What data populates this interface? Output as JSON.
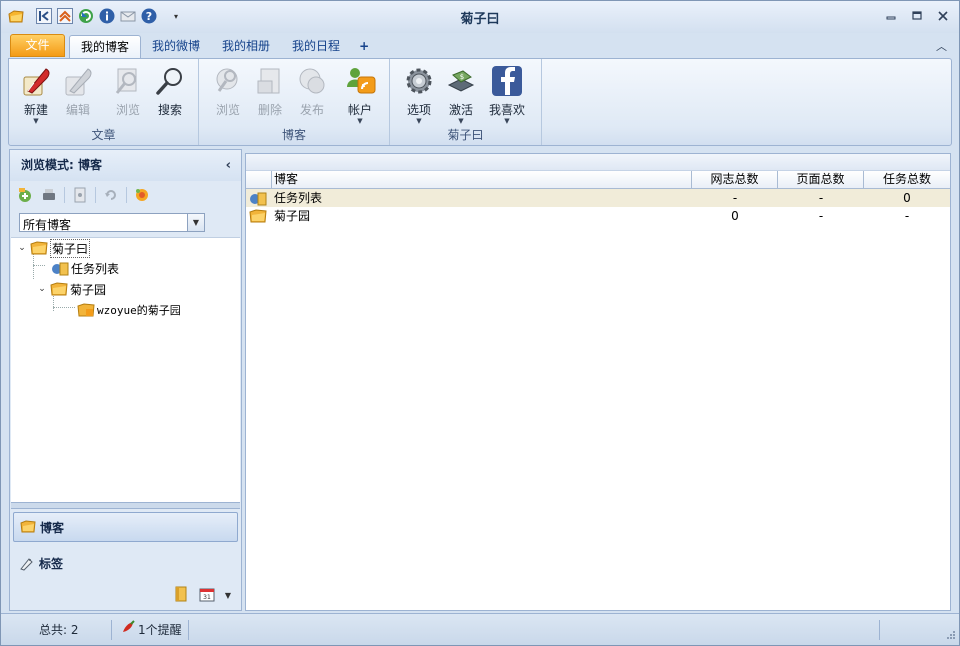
{
  "window": {
    "title": "菊子曰"
  },
  "quick_access": [
    "app-logo-icon",
    "back-icon",
    "home-icon",
    "refresh-icon",
    "info-icon",
    "mail-icon",
    "help-icon",
    "customize-dropdown-icon"
  ],
  "tabs": {
    "file": "文件",
    "items": [
      {
        "label": "我的博客",
        "active": true
      },
      {
        "label": "我的微博",
        "active": false
      },
      {
        "label": "我的相册",
        "active": false
      },
      {
        "label": "我的日程",
        "active": false
      },
      {
        "label": "+",
        "active": false
      }
    ]
  },
  "ribbon": {
    "groups": [
      {
        "label": "文章",
        "buttons": [
          {
            "label": "新建",
            "icon": "quill-pen-icon",
            "enabled": true,
            "dropdown": true
          },
          {
            "label": "编辑",
            "icon": "edit-icon",
            "enabled": false,
            "dropdown": false
          },
          {
            "label": "浏览",
            "icon": "browse-magnifier-icon",
            "enabled": false,
            "dropdown": false
          },
          {
            "label": "搜索",
            "icon": "search-icon",
            "enabled": true,
            "dropdown": false
          }
        ]
      },
      {
        "label": "博客",
        "buttons": [
          {
            "label": "浏览",
            "icon": "browse-icon",
            "enabled": false,
            "dropdown": false
          },
          {
            "label": "删除",
            "icon": "delete-icon",
            "enabled": false,
            "dropdown": false
          },
          {
            "label": "发布",
            "icon": "publish-icon",
            "enabled": false,
            "dropdown": false
          },
          {
            "label": "帐户",
            "icon": "account-icon",
            "enabled": true,
            "dropdown": true
          }
        ]
      },
      {
        "label": "菊子曰",
        "buttons": [
          {
            "label": "选项",
            "icon": "gear-icon",
            "enabled": true,
            "dropdown": true
          },
          {
            "label": "激活",
            "icon": "activate-icon",
            "enabled": true,
            "dropdown": true
          },
          {
            "label": "我喜欢",
            "icon": "facebook-icon",
            "enabled": true,
            "dropdown": true
          }
        ]
      }
    ]
  },
  "left_panel": {
    "header": "浏览模式: 博客",
    "filter_value": "所有博客",
    "tree": [
      {
        "label": "菊子曰",
        "level": 0,
        "expanded": true,
        "selected": true
      },
      {
        "label": "任务列表",
        "level": 1
      },
      {
        "label": "菊子园",
        "level": 1,
        "expanded": true
      },
      {
        "label": "wzoyue的菊子园",
        "level": 2
      }
    ],
    "nav": [
      {
        "label": "博客",
        "active": true
      },
      {
        "label": "标签",
        "active": false
      }
    ]
  },
  "grid": {
    "columns": [
      "博客",
      "网志总数",
      "页面总数",
      "任务总数"
    ],
    "rows": [
      {
        "name": "任务列表",
        "posts": "-",
        "pages": "-",
        "tasks": "0"
      },
      {
        "name": "菊子园",
        "posts": "0",
        "pages": "-",
        "tasks": "-"
      }
    ]
  },
  "status": {
    "total": "总共: 2",
    "reminders": "1个提醒"
  },
  "colors": {
    "file_tab": "#f49b16",
    "ribbon_bg": "#dfe9f5",
    "selected_row": "#f1ecd9"
  }
}
